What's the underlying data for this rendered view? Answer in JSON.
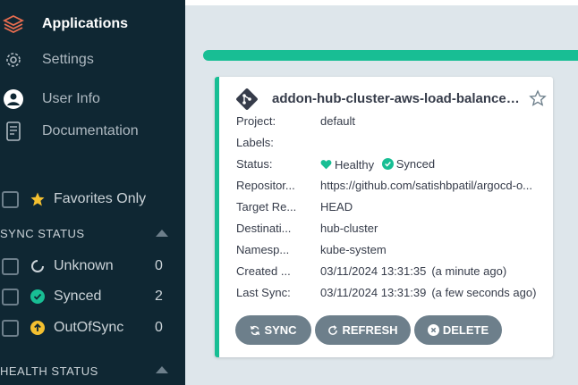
{
  "sidebar": {
    "nav": [
      {
        "label": "Applications",
        "icon": "layers-icon"
      },
      {
        "label": "Settings",
        "icon": "gears-icon"
      },
      {
        "label": "User Info",
        "icon": "user-circle-icon"
      },
      {
        "label": "Documentation",
        "icon": "book-icon"
      }
    ],
    "favorites_label": "Favorites Only",
    "sync_status": {
      "title": "SYNC STATUS",
      "items": [
        {
          "label": "Unknown",
          "count": "0"
        },
        {
          "label": "Synced",
          "count": "2"
        },
        {
          "label": "OutOfSync",
          "count": "0"
        }
      ]
    },
    "health_status": {
      "title": "HEALTH STATUS"
    }
  },
  "app_card": {
    "title": "addon-hub-cluster-aws-load-balancer-...",
    "fields": [
      {
        "key": "Project:",
        "value": "default"
      },
      {
        "key": "Labels:",
        "value": ""
      },
      {
        "key": "Status:",
        "value": ""
      },
      {
        "key": "Repositor...",
        "value": "https://github.com/satishbpatil/argocd-o..."
      },
      {
        "key": "Target Re...",
        "value": "HEAD"
      },
      {
        "key": "Destinati...",
        "value": "hub-cluster"
      },
      {
        "key": "Namesp...",
        "value": "kube-system"
      },
      {
        "key": "Created ...",
        "value": "03/11/2024 13:31:35",
        "relative": "(a minute ago)"
      },
      {
        "key": "Last Sync:",
        "value": "03/11/2024 13:31:39",
        "relative": "(a few seconds ago)"
      }
    ],
    "health": "Healthy",
    "sync": "Synced",
    "buttons": {
      "sync": "SYNC",
      "refresh": "REFRESH",
      "delete": "DELETE"
    }
  },
  "colors": {
    "sidebar_bg": "#0f2733",
    "accent": "#18be94",
    "button": "#6d7f8b",
    "favorite": "#f4c030",
    "out_of_sync": "#f4c030"
  }
}
